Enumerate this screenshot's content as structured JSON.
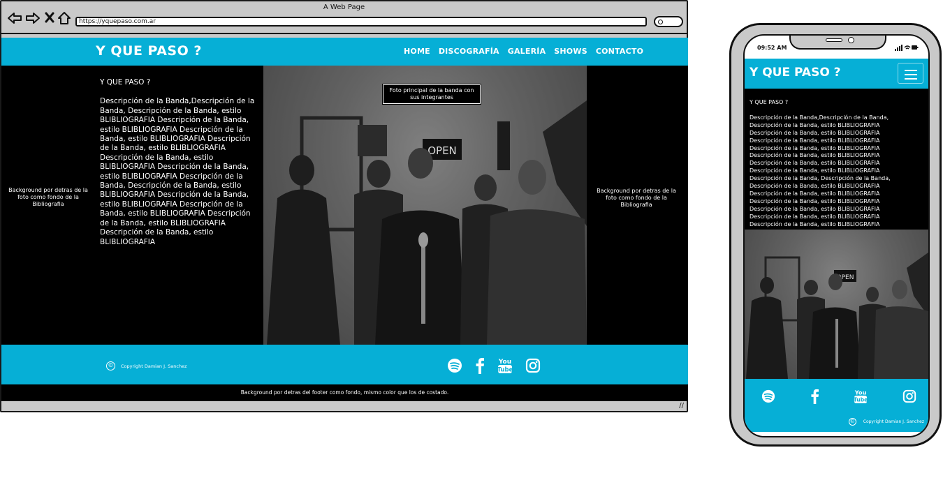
{
  "browser": {
    "window_title": "A Web Page",
    "url": "https://yquepaso.com.ar"
  },
  "site": {
    "brand": "Y QUE PASO ?",
    "nav": [
      "HOME",
      "DISCOGRAFÍA",
      "GALERÍA",
      "SHOWS",
      "CONTACTO"
    ],
    "side_note_left": "Background por detras de la foto como fondo de la Bibliografia",
    "side_note_right": "Background por detras de la foto como fondo de la Bibliografia",
    "photo_caption": "Foto principal de la banda con sus integrantes",
    "footer_copyright": "Copyright Damian J. Sanchez",
    "footer_note": "Background por detras del footer como fondo, mismo color que los de costado.",
    "colors": {
      "accent": "#06afd6",
      "background": "#000000"
    },
    "social_icons": [
      "spotify-icon",
      "facebook-icon",
      "youtube-icon",
      "instagram-icon"
    ]
  },
  "bio": {
    "title": "Y QUE PASO ?",
    "paragraph": "Descripción de la Banda,Descripción de la Banda, Descripción de la Banda, estilo BLIBLIOGRAFIA Descripción de la Banda, estilo BLIBLIOGRAFIA Descripción de la Banda, estilo BLIBLIOGRAFIA Descripción de la Banda, estilo BLIBLIOGRAFIA Descripción de la Banda, estilo BLIBLIOGRAFIA Descripción de la Banda, estilo BLIBLIOGRAFIA Descripción de la Banda, Descripción de la Banda, estilo BLIBLIOGRAFIA Descripción de la Banda, estilo BLIBLIOGRAFIA Descripción de la Banda, estilo BLIBLIOGRAFIA Descripción de la Banda, estilo BLIBLIOGRAFIA Descripción de la Banda, estilo BLIBLIOGRAFIA"
  },
  "mobile": {
    "status_time": "09:52 AM",
    "bio_title": "Y QUE PASO ?",
    "bio_lines": [
      "Descripción de la Banda,Descripción de la Banda,",
      "Descripción de la Banda, estilo BLIBLIOGRAFIA",
      "Descripción de la Banda, estilo BLIBLIOGRAFIA",
      "Descripción de la Banda, estilo BLIBLIOGRAFIA",
      "Descripción de la Banda, estilo BLIBLIOGRAFIA",
      "Descripción de la Banda, estilo BLIBLIOGRAFIA",
      "Descripción de la Banda, estilo BLIBLIOGRAFIA",
      "Descripción de la Banda, estilo BLIBLIOGRAFIA",
      "Descripción de la Banda, Descripción de la Banda,",
      "Descripción de la Banda, estilo BLIBLIOGRAFIA",
      "Descripción de la Banda, estilo BLIBLIOGRAFIA",
      "Descripción de la Banda, estilo BLIBLIOGRAFIA",
      "Descripción de la Banda, estilo BLIBLIOGRAFIA",
      "Descripción de la Banda, estilo BLIBLIOGRAFIA",
      "Descripción de la Banda, estilo BLIBLIOGRAFIA"
    ],
    "footer_copyright": "Copyright Damian J. Sanchez"
  }
}
